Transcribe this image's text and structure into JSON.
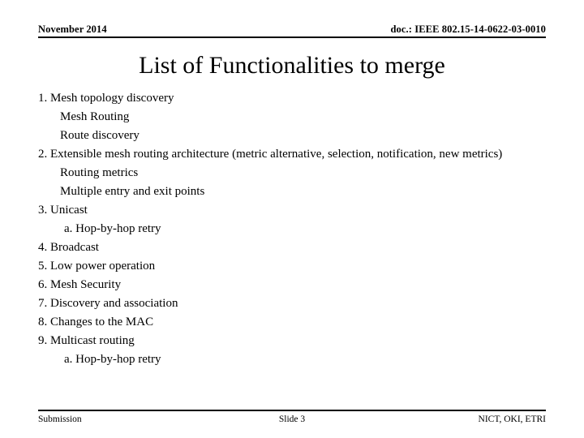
{
  "header": {
    "date": "November 2014",
    "doc_id": "doc.: IEEE 802.15-14-0622-03-0010"
  },
  "title": "List of Functionalities to merge",
  "body": {
    "lines": [
      {
        "text": "1. Mesh topology discovery",
        "level": 0
      },
      {
        "text": "Mesh Routing",
        "level": 1
      },
      {
        "text": "Route discovery",
        "level": 1
      },
      {
        "text": "2. Extensible mesh routing architecture (metric alternative, selection, notification, new metrics)",
        "level": 0
      },
      {
        "text": "Routing metrics",
        "level": 1
      },
      {
        "text": "Multiple entry and exit points",
        "level": 1
      },
      {
        "text": "3. Unicast",
        "level": 0
      },
      {
        "text": "a. Hop-by-hop retry",
        "level": 2
      },
      {
        "text": "4. Broadcast",
        "level": 0
      },
      {
        "text": "5. Low power operation",
        "level": 0
      },
      {
        "text": "6. Mesh Security",
        "level": 0
      },
      {
        "text": "7. Discovery and association",
        "level": 0
      },
      {
        "text": "8. Changes to the MAC",
        "level": 0
      },
      {
        "text": "9. Multicast routing",
        "level": 0
      },
      {
        "text": "a. Hop-by-hop retry",
        "level": 2
      }
    ]
  },
  "footer": {
    "left": "Submission",
    "center": "Slide 3",
    "right": "NICT, OKI, ETRI"
  },
  "colors": {
    "text": "#000000",
    "background": "#ffffff",
    "rule": "#000000"
  }
}
